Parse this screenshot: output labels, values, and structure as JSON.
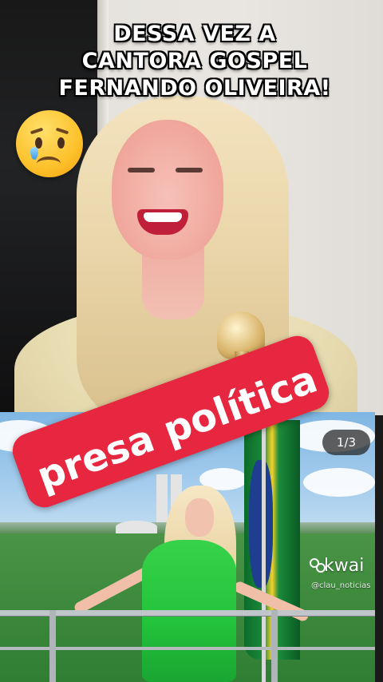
{
  "caption": {
    "lines": [
      "DESSA VEZ A",
      "CANTORA GOSPEL",
      "FERNANDO OLIVEIRA!"
    ]
  },
  "emoji": {
    "icon": "sad-face-with-tear-icon"
  },
  "stamp": {
    "text": "presa política",
    "color": "#e7263f"
  },
  "photo_counter": {
    "current": 1,
    "total": 3,
    "label": "1/3"
  },
  "watermark": {
    "brand": "kwai",
    "username": "@clau_noticias"
  },
  "colors": {
    "dress": "#22c23a",
    "flag_green": "#1b8b3a",
    "flag_yellow": "#f4d02a",
    "flag_blue": "#1e3f8f"
  }
}
